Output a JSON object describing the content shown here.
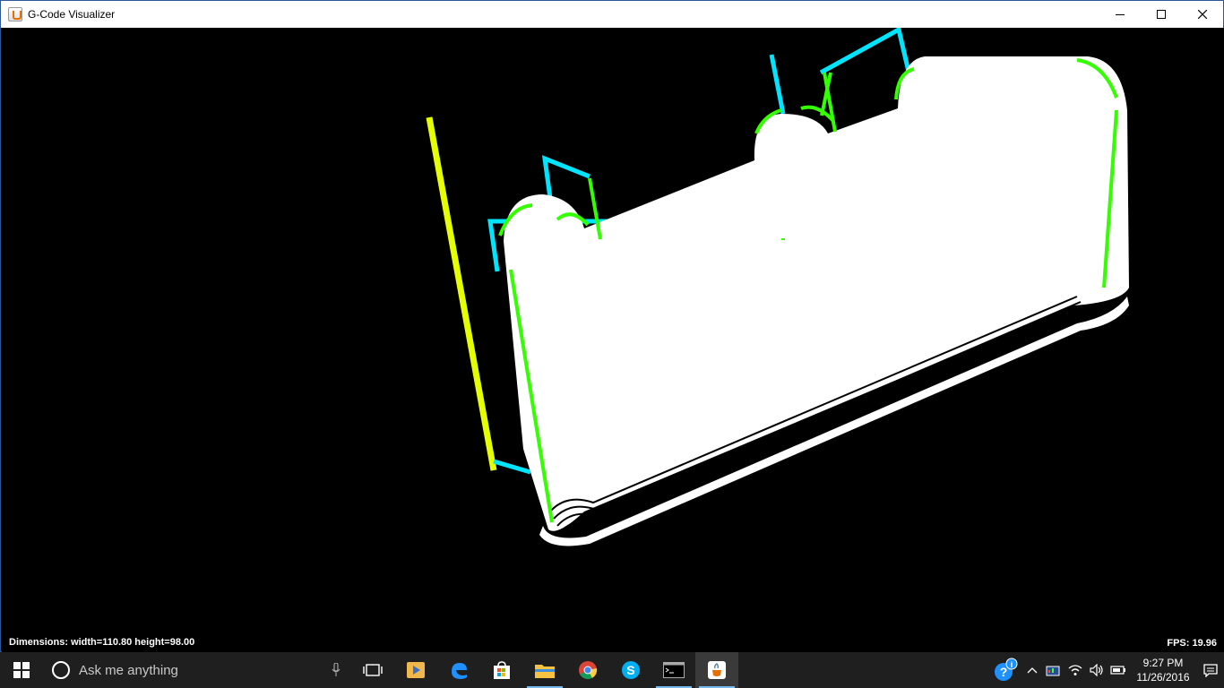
{
  "window": {
    "title": "G-Code Visualizer",
    "app_icon": "java-icon",
    "controls": [
      "minimize-icon",
      "maximize-icon",
      "close-icon"
    ]
  },
  "canvas": {
    "dimensions_text": "Dimensions: width=110.80 height=98.00",
    "fps_text": "FPS: 19.96",
    "background_color": "#000000",
    "colors": {
      "model": "#ffffff",
      "travel": "#00e5ff",
      "extrude": "#33ff00",
      "retract": "#e6ff00"
    }
  },
  "taskbar": {
    "search_placeholder": "Ask me anything",
    "apps": [
      "task-view-icon",
      "vlc-icon",
      "edge-icon",
      "store-icon",
      "file-explorer-icon",
      "chrome-icon",
      "skype-icon",
      "cmd-icon",
      "java-icon"
    ],
    "clock_time": "9:27 PM",
    "clock_date": "11/26/2016",
    "tray_icons": [
      "help-icon",
      "chevron-up-icon",
      "network-monitor-icon",
      "wifi-icon",
      "volume-icon",
      "battery-icon",
      "action-center-icon"
    ]
  }
}
